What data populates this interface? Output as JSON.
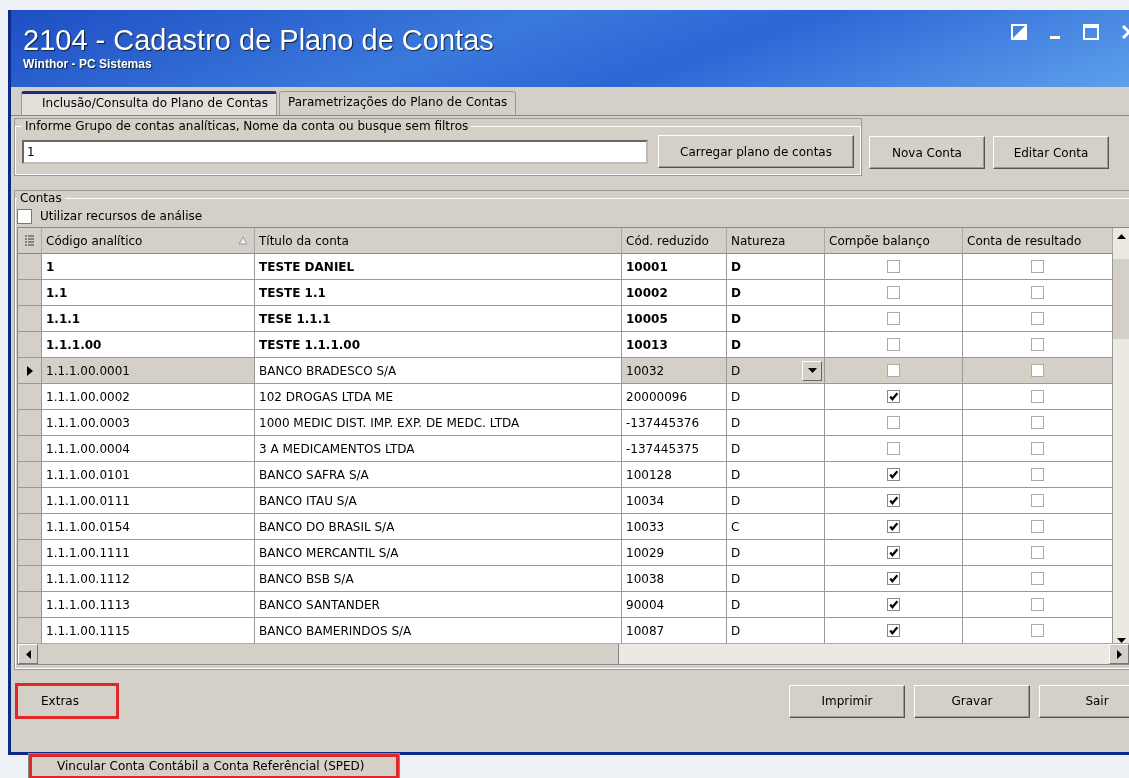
{
  "window": {
    "title": "2104 - Cadastro de Plano de Contas",
    "subtitle": "Winthor - PC Sistemas"
  },
  "tabs": [
    {
      "label": "Inclusão/Consulta do Plano de Contas",
      "selected": true
    },
    {
      "label": "Parametrizações do Plano de Contas",
      "selected": false
    }
  ],
  "filter": {
    "legend": "Informe Grupo de contas analíticas, Nome da conta ou busque sem filtros",
    "value": "1",
    "load_button": "Carregar plano de contas"
  },
  "top_buttons": [
    "Nova Conta",
    "Editar Conta"
  ],
  "accounts": {
    "legend": "Contas",
    "analysis_checkbox": {
      "label": "Utilizar recursos de análise",
      "checked": false
    }
  },
  "table": {
    "columns": [
      "Código analítico",
      "Título da conta",
      "Cód. reduzido",
      "Natureza",
      "Compõe balanço",
      "Conta de resultado"
    ],
    "rows": [
      {
        "code": "1",
        "title": "TESTE DANIEL",
        "short": "10001",
        "nature": "D",
        "compoe": false,
        "resultado": false,
        "bold": true,
        "selected": false
      },
      {
        "code": "1.1",
        "title": "TESTE 1.1",
        "short": "10002",
        "nature": "D",
        "compoe": false,
        "resultado": false,
        "bold": true,
        "selected": false
      },
      {
        "code": "1.1.1",
        "title": "TESE 1.1.1",
        "short": "10005",
        "nature": "D",
        "compoe": false,
        "resultado": false,
        "bold": true,
        "selected": false
      },
      {
        "code": "1.1.1.00",
        "title": "TESTE 1.1.1.00",
        "short": "10013",
        "nature": "D",
        "compoe": false,
        "resultado": false,
        "bold": true,
        "selected": false
      },
      {
        "code": "1.1.1.00.0001",
        "title": "BANCO BRADESCO S/A",
        "short": "10032",
        "nature": "D",
        "compoe": false,
        "resultado": false,
        "bold": false,
        "selected": true
      },
      {
        "code": "1.1.1.00.0002",
        "title": "102 DROGAS LTDA ME",
        "short": "20000096",
        "nature": "D",
        "compoe": true,
        "resultado": false,
        "bold": false,
        "selected": false
      },
      {
        "code": "1.1.1.00.0003",
        "title": "1000 MEDIC DIST. IMP. EXP. DE MEDC. LTDA",
        "short": "-137445376",
        "nature": "D",
        "compoe": false,
        "resultado": false,
        "bold": false,
        "selected": false
      },
      {
        "code": "1.1.1.00.0004",
        "title": "3 A MEDICAMENTOS LTDA",
        "short": "-137445375",
        "nature": "D",
        "compoe": false,
        "resultado": false,
        "bold": false,
        "selected": false
      },
      {
        "code": "1.1.1.00.0101",
        "title": "BANCO SAFRA S/A",
        "short": "100128",
        "nature": "D",
        "compoe": true,
        "resultado": false,
        "bold": false,
        "selected": false
      },
      {
        "code": "1.1.1.00.0111",
        "title": "BANCO ITAU S/A",
        "short": "10034",
        "nature": "D",
        "compoe": true,
        "resultado": false,
        "bold": false,
        "selected": false
      },
      {
        "code": "1.1.1.00.0154",
        "title": "BANCO DO BRASIL S/A",
        "short": "10033",
        "nature": "C",
        "compoe": true,
        "resultado": false,
        "bold": false,
        "selected": false
      },
      {
        "code": "1.1.1.00.1111",
        "title": "BANCO MERCANTIL S/A",
        "short": "10029",
        "nature": "D",
        "compoe": true,
        "resultado": false,
        "bold": false,
        "selected": false
      },
      {
        "code": "1.1.1.00.1112",
        "title": "BANCO BSB S/A",
        "short": "10038",
        "nature": "D",
        "compoe": true,
        "resultado": false,
        "bold": false,
        "selected": false
      },
      {
        "code": "1.1.1.00.1113",
        "title": "BANCO SANTANDER",
        "short": "90004",
        "nature": "D",
        "compoe": true,
        "resultado": false,
        "bold": false,
        "selected": false
      },
      {
        "code": "1.1.1.00.1115",
        "title": "BANCO BAMERINDOS S/A",
        "short": "10087",
        "nature": "D",
        "compoe": true,
        "resultado": false,
        "bold": false,
        "selected": false
      }
    ]
  },
  "extras_button": {
    "label": "Extras",
    "highlighted": true
  },
  "bottom_buttons": [
    "Imprimir",
    "Gravar",
    "Sair"
  ],
  "extras_menu": [
    {
      "label": "Vincular Conta Contábil a Conta Referêncial (SPED)",
      "highlighted": true
    }
  ]
}
